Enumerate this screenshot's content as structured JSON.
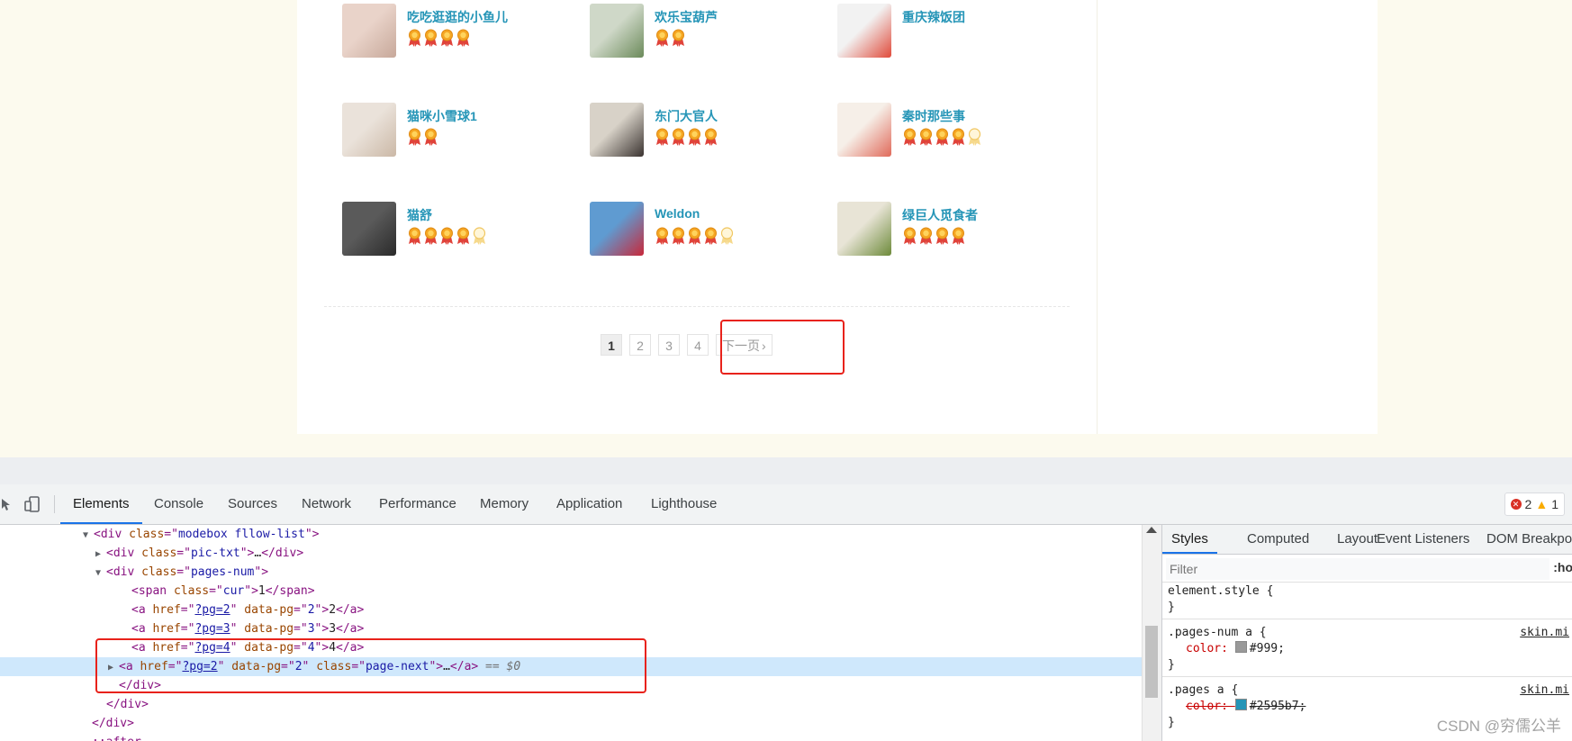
{
  "users": [
    {
      "name": "吃吃逛逛的小鱼儿",
      "full_medals": 4,
      "empty_medals": 0,
      "avatar_colors": [
        "#e9d3c9",
        "#c7a89a"
      ]
    },
    {
      "name": "欢乐宝葫芦",
      "full_medals": 2,
      "empty_medals": 0,
      "avatar_colors": [
        "#cfd8c8",
        "#6b8a5a"
      ]
    },
    {
      "name": "重庆辣饭团",
      "full_medals": 0,
      "empty_medals": 0,
      "avatar_colors": [
        "#f2f2f2",
        "#e04a3a"
      ]
    },
    {
      "name": "猫咪小雪球1",
      "full_medals": 2,
      "empty_medals": 0,
      "avatar_colors": [
        "#eae2da",
        "#cbb8a6"
      ]
    },
    {
      "name": "东门大官人",
      "full_medals": 4,
      "empty_medals": 0,
      "avatar_colors": [
        "#d8d2c8",
        "#3a3330"
      ]
    },
    {
      "name": "秦时那些事",
      "full_medals": 4,
      "empty_medals": 1,
      "avatar_colors": [
        "#f6efe8",
        "#e06a5a"
      ]
    },
    {
      "name": "猫舒",
      "full_medals": 4,
      "empty_medals": 1,
      "avatar_colors": [
        "#5a5a5a",
        "#2a2a2a"
      ]
    },
    {
      "name": "Weldon",
      "full_medals": 4,
      "empty_medals": 1,
      "avatar_colors": [
        "#5f9bd1",
        "#c8283a"
      ]
    },
    {
      "name": "绿巨人觅食者",
      "full_medals": 4,
      "empty_medals": 0,
      "avatar_colors": [
        "#e8e4d6",
        "#6d8a3a"
      ]
    }
  ],
  "pagination": {
    "current": "1",
    "pages": [
      "2",
      "3",
      "4"
    ],
    "next_label": "下一页",
    "next_icon": "chevron-right-icon"
  },
  "devtools": {
    "tabs": [
      "Elements",
      "Console",
      "Sources",
      "Network",
      "Performance",
      "Memory",
      "Application",
      "Lighthouse"
    ],
    "active_tab": "Elements",
    "error_count": "2",
    "warning_count": "1",
    "dom_lines": [
      {
        "parts": [
          [
            "tag",
            "<div "
          ],
          [
            "attr",
            "class"
          ],
          [
            "tag",
            "=\""
          ],
          [
            "val",
            "modebox fllow-list"
          ],
          [
            "tag",
            "\">"
          ]
        ],
        "tri": "down"
      },
      {
        "parts": [
          [
            "tag",
            "<div "
          ],
          [
            "attr",
            "class"
          ],
          [
            "tag",
            "=\""
          ],
          [
            "val",
            "pic-txt"
          ],
          [
            "tag",
            "\">"
          ],
          [
            "txt",
            "…"
          ],
          [
            "tag",
            "</div>"
          ]
        ],
        "tri": "right"
      },
      {
        "parts": [
          [
            "tag",
            "<div "
          ],
          [
            "attr",
            "class"
          ],
          [
            "tag",
            "=\""
          ],
          [
            "val",
            "pages-num"
          ],
          [
            "tag",
            "\">"
          ]
        ],
        "tri": "down"
      },
      {
        "parts": [
          [
            "tag",
            "<span "
          ],
          [
            "attr",
            "class"
          ],
          [
            "tag",
            "=\""
          ],
          [
            "val",
            "cur"
          ],
          [
            "tag",
            "\">"
          ],
          [
            "txt",
            "1"
          ],
          [
            "tag",
            "</span>"
          ]
        ],
        "tri": ""
      },
      {
        "parts": [
          [
            "tag",
            "<a "
          ],
          [
            "attr",
            "href"
          ],
          [
            "tag",
            "=\""
          ],
          [
            "link",
            "?pg=2"
          ],
          [
            "tag",
            "\" "
          ],
          [
            "attr",
            "data-pg"
          ],
          [
            "tag",
            "=\""
          ],
          [
            "val",
            "2"
          ],
          [
            "tag",
            "\">"
          ],
          [
            "txt",
            "2"
          ],
          [
            "tag",
            "</a>"
          ]
        ],
        "tri": ""
      },
      {
        "parts": [
          [
            "tag",
            "<a "
          ],
          [
            "attr",
            "href"
          ],
          [
            "tag",
            "=\""
          ],
          [
            "link",
            "?pg=3"
          ],
          [
            "tag",
            "\" "
          ],
          [
            "attr",
            "data-pg"
          ],
          [
            "tag",
            "=\""
          ],
          [
            "val",
            "3"
          ],
          [
            "tag",
            "\">"
          ],
          [
            "txt",
            "3"
          ],
          [
            "tag",
            "</a>"
          ]
        ],
        "tri": ""
      },
      {
        "parts": [
          [
            "tag",
            "<a "
          ],
          [
            "attr",
            "href"
          ],
          [
            "tag",
            "=\""
          ],
          [
            "link",
            "?pg=4"
          ],
          [
            "tag",
            "\" "
          ],
          [
            "attr",
            "data-pg"
          ],
          [
            "tag",
            "=\""
          ],
          [
            "val",
            "4"
          ],
          [
            "tag",
            "\">"
          ],
          [
            "txt",
            "4"
          ],
          [
            "tag",
            "</a>"
          ]
        ],
        "tri": ""
      },
      {
        "parts": [
          [
            "tag",
            "<a "
          ],
          [
            "attr",
            "href"
          ],
          [
            "tag",
            "=\""
          ],
          [
            "link",
            "?pg=2"
          ],
          [
            "tag",
            "\" "
          ],
          [
            "attr",
            "data-pg"
          ],
          [
            "tag",
            "=\""
          ],
          [
            "val",
            "2"
          ],
          [
            "tag",
            "\" "
          ],
          [
            "attr",
            "class"
          ],
          [
            "tag",
            "=\""
          ],
          [
            "val",
            "page-next"
          ],
          [
            "tag",
            "\">"
          ],
          [
            "txt",
            "…"
          ],
          [
            "tag",
            "</a>"
          ],
          [
            "eq",
            " == $0"
          ]
        ],
        "tri": "right",
        "selected": true
      },
      {
        "parts": [
          [
            "tag",
            "</div>"
          ]
        ],
        "tri": ""
      },
      {
        "parts": [
          [
            "tag",
            "</div>"
          ]
        ],
        "tri": ""
      },
      {
        "parts": [
          [
            "tag",
            "</div>"
          ]
        ],
        "tri": ""
      },
      {
        "parts": [
          [
            "tag",
            "::after"
          ]
        ],
        "tri": ""
      }
    ],
    "styles_tabs": [
      "Styles",
      "Computed",
      "Layout",
      "Event Listeners",
      "DOM Breakpoi"
    ],
    "filter_placeholder": "Filter",
    "hov_label": ":ho",
    "rules": [
      {
        "selector": "element.style {",
        "props": [],
        "source": ""
      },
      {
        "selector": ".pages-num a {",
        "props": [
          {
            "name": "color",
            "value": "#999;",
            "swatch": "#999999",
            "struck": false
          }
        ],
        "source": "skin.mi"
      },
      {
        "selector": ".pages a {",
        "props": [
          {
            "name": "color",
            "value": "#2595b7;",
            "swatch": "#2595b7",
            "struck": true
          }
        ],
        "source": "skin.mi"
      }
    ]
  },
  "watermark": "CSDN @穷儒公羊",
  "colors": {
    "link": "#2595b7",
    "highlight": "#e8221b",
    "medal": "#f5a623",
    "devtools_accent": "#1a73e8"
  }
}
